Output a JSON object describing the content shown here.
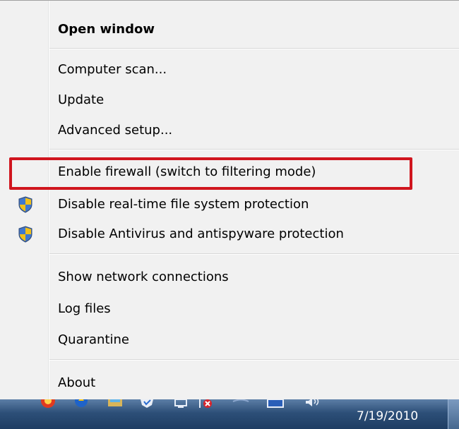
{
  "menu": {
    "items": [
      {
        "label": "Open window",
        "bold": true
      },
      {
        "label": "Computer scan..."
      },
      {
        "label": "Update"
      },
      {
        "label": "Advanced setup..."
      },
      {
        "label": "Enable firewall (switch to filtering mode)",
        "highlighted": true
      },
      {
        "label": "Disable real-time file system protection",
        "icon": "uac-shield-icon"
      },
      {
        "label": "Disable Antivirus and antispyware protection",
        "icon": "uac-shield-icon"
      },
      {
        "label": "Show network connections"
      },
      {
        "label": "Log files"
      },
      {
        "label": "Quarantine"
      },
      {
        "label": "About"
      }
    ]
  },
  "taskbar": {
    "clock_date": "7/19/2010",
    "tray_icons": [
      "eset-icon",
      "security-icon",
      "folder-icon",
      "shield-check-icon",
      "network-icon",
      "network-error-icon",
      "network-activity-icon",
      "monitor-icon",
      "volume-icon"
    ]
  },
  "colors": {
    "highlight_border": "#d0151e",
    "menu_background": "#f1f1f1",
    "taskbar": "#2d4f78"
  }
}
